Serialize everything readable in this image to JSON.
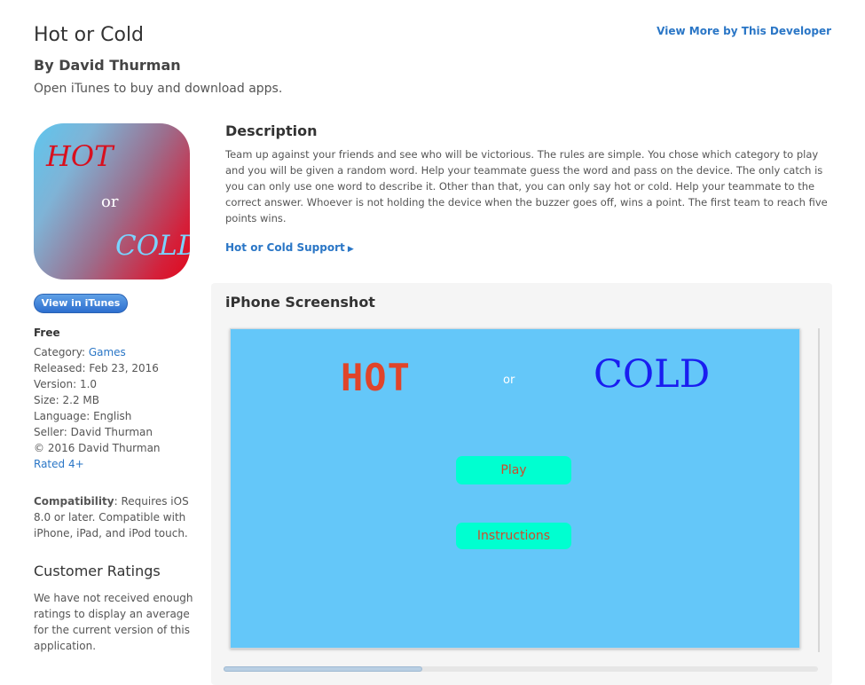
{
  "header": {
    "title": "Hot or Cold",
    "developer": "By David Thurman",
    "open_itunes": "Open iTunes to buy and download apps.",
    "view_more": "View More by This Developer"
  },
  "icon": {
    "hot": "HOT",
    "or": "or",
    "cold": "COLD"
  },
  "sidebar": {
    "view_in_itunes": "View in iTunes",
    "price": "Free",
    "category_label": "Category: ",
    "category_value": "Games",
    "released": "Released: Feb 23, 2016",
    "version": "Version: 1.0",
    "size": "Size: 2.2 MB",
    "language": "Language: English",
    "seller": "Seller: David Thurman",
    "copyright": "© 2016 David Thurman",
    "rated": "Rated 4+",
    "compat_label": "Compatibility",
    "compat_text": ": Requires iOS 8.0 or later. Compatible with iPhone, iPad, and iPod touch.",
    "ratings_title": "Customer Ratings",
    "ratings_text": "We have not received enough ratings to display an average for the current version of this application."
  },
  "description": {
    "title": "Description",
    "text": "Team up against your friends and see who will be victorious. The rules are simple. You chose which category to play and you will be given a random word. Help your teammate guess the word and pass on the device. The only catch is you can only use one word to describe it. Other than that, you can only say hot or cold. Help your teammate to the correct answer. Whoever is not holding the device when the buzzer goes off, wins a point. The first team to reach five points wins.",
    "support_link": "Hot or Cold Support"
  },
  "screenshot": {
    "title": "iPhone Screenshot",
    "hot": "HOT",
    "or": "or",
    "cold": "COLD",
    "play": "Play",
    "instructions": "Instructions"
  },
  "colors": {
    "link": "#2a76c6",
    "screenshot_bg": "#64c7f9",
    "button_bg": "#00ffd0"
  }
}
